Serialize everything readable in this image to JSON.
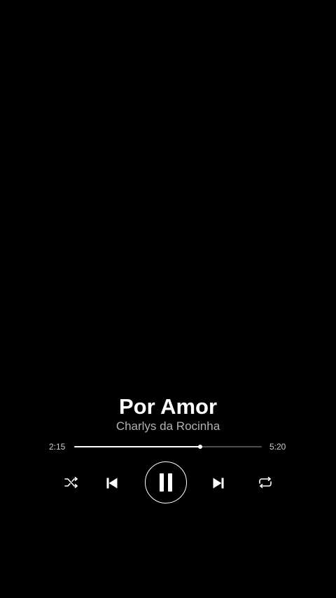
{
  "player": {
    "title": "Por Amor",
    "artist": "Charlys da Rocinha",
    "elapsed": "2:15",
    "duration": "5:20",
    "progress_fraction": 0.672,
    "state": "playing"
  },
  "controls": {
    "shuffle_icon": "shuffle-icon",
    "previous_icon": "skip-previous-icon",
    "play_pause_icon": "pause-icon",
    "next_icon": "skip-next-icon",
    "repeat_icon": "repeat-icon"
  },
  "colors": {
    "background": "#000000",
    "text_primary": "#ffffff",
    "text_secondary": "#b3b3b3",
    "progress_played": "#ffffff",
    "progress_remaining": "#4d4d4d"
  }
}
